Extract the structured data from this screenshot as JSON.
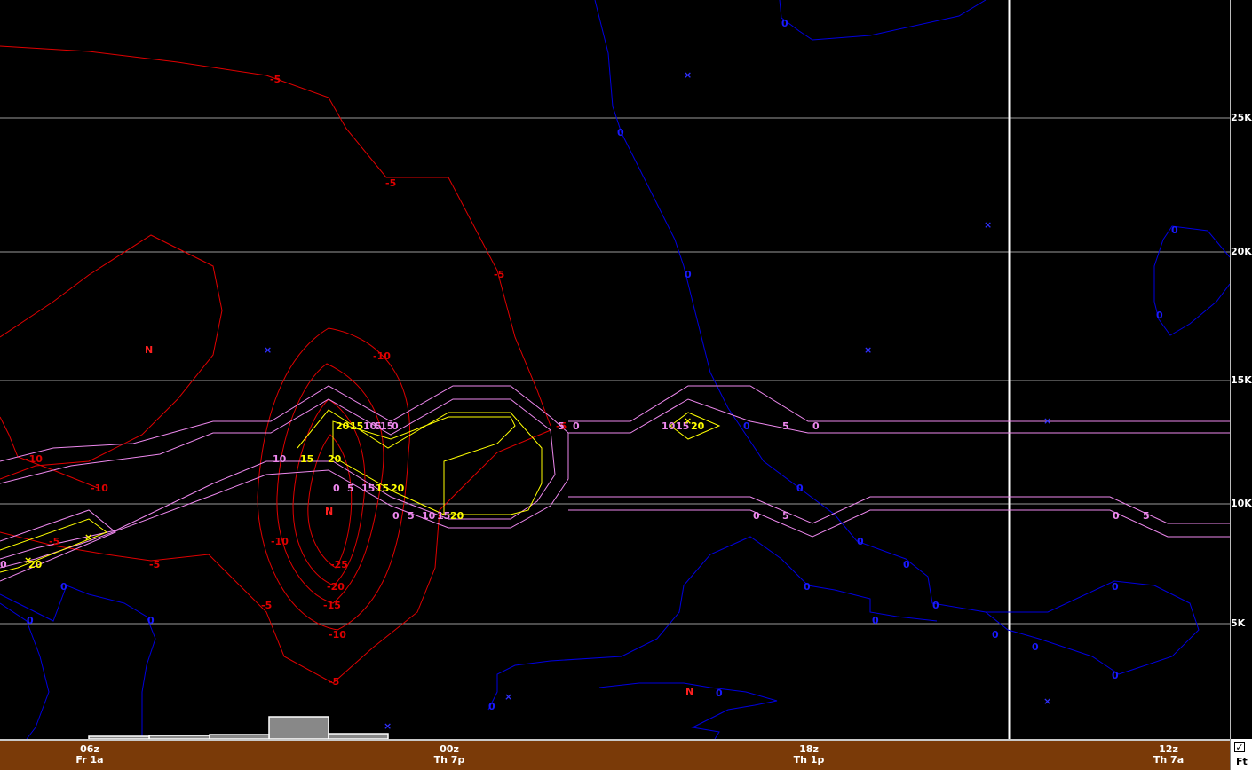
{
  "colors": {
    "background": "#000000",
    "grid": "#9a9a9a",
    "temperature": "#e00000",
    "dewpoint": "#0000e0",
    "icing_outer": "#ee88ee",
    "icing_inner": "#ffff00",
    "time_bar": "#7a3a08",
    "now_line": "#ffffff"
  },
  "altitude_axis": {
    "labels": [
      {
        "text": "25K",
        "ft": 25000
      },
      {
        "text": "20K",
        "ft": 20000
      },
      {
        "text": "15K",
        "ft": 15000
      },
      {
        "text": "10K",
        "ft": 10000
      },
      {
        "text": "5K",
        "ft": 5000
      }
    ]
  },
  "time_axis": {
    "labels": [
      {
        "utc": "06z",
        "local": "Fr 1a"
      },
      {
        "utc": "00z",
        "local": "Th 7p"
      },
      {
        "utc": "18z",
        "local": "Th 1p"
      },
      {
        "utc": "12z",
        "local": "Th 7a"
      }
    ]
  },
  "units": {
    "checked": "✓",
    "label": "Ft"
  },
  "contour_labels": {
    "temperature": [
      "-5",
      "-5",
      "-5",
      "-10",
      "-10",
      "-10",
      "-5",
      "-10",
      "-25",
      "-20",
      "-15",
      "-10",
      "-5",
      "-5",
      "-5",
      "-5",
      "-10"
    ],
    "dewpoint": [
      "0",
      "0",
      "0",
      "0",
      "0",
      "0",
      "0",
      "0",
      "0",
      "0",
      "0",
      "0",
      "0",
      "0",
      "0",
      "0",
      "0",
      "0",
      "0",
      "0",
      "0"
    ],
    "icing_outer": [
      "10",
      "15",
      "5",
      "0",
      "0",
      "5",
      "10",
      "15",
      "0",
      "5",
      "10",
      "15",
      "10",
      "15",
      "0",
      "5",
      "0",
      "5",
      "0",
      "5",
      "0",
      "5",
      "0",
      "5",
      "5",
      "5"
    ],
    "icing_inner": [
      "20",
      "15",
      "10",
      "5",
      "20",
      "20",
      "20",
      "20",
      "20",
      "15",
      "20",
      "20"
    ],
    "low_markers": [
      "N",
      "N",
      "N"
    ],
    "x_markers": [
      "×",
      "×",
      "×",
      "×",
      "×",
      "×",
      "×",
      "×",
      "×",
      "×",
      "×",
      "×"
    ]
  }
}
